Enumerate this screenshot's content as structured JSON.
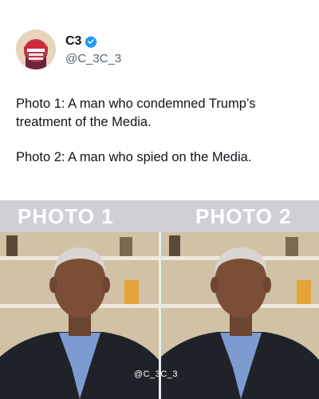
{
  "post": {
    "display_name": "C3",
    "handle": "@C_3C_3",
    "text_lines": [
      "Photo 1: A man who condemned Trump’s treatment of the Media.",
      "Photo 2: A man who spied on the Media."
    ]
  },
  "image": {
    "label_1": "PHOTO 1",
    "label_2": "PHOTO 2",
    "watermark": "@C_3C_3"
  },
  "icons": {
    "verified": "verified-badge-icon"
  },
  "colors": {
    "verified": "#1d9bf0",
    "handle": "#536471",
    "text": "#0f1419"
  }
}
